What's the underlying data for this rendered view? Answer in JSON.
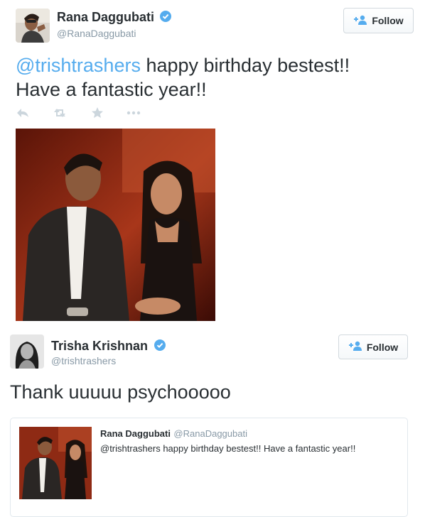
{
  "tweet1": {
    "user": {
      "name": "Rana Daggubati",
      "handle": "@RanaDaggubati",
      "verified": true
    },
    "follow_label": "Follow",
    "text_mention": "@trishtrashers",
    "text_rest": " happy birthday bestest!!",
    "text_line2": "Have a fantastic year!!",
    "actions": [
      "reply-icon",
      "retweet-icon",
      "favorite-icon",
      "more-icon"
    ]
  },
  "tweet2": {
    "user": {
      "name": "Trisha Krishnan",
      "handle": "@trishtrashers",
      "verified": true
    },
    "follow_label": "Follow",
    "text": "Thank uuuuu psychooooo",
    "quoted": {
      "name": "Rana Daggubati",
      "handle": "@RanaDaggubati",
      "text": "@trishtrashers happy birthday bestest!! Have a fantastic year!!"
    }
  },
  "colors": {
    "accent": "#55acee",
    "text": "#292f33",
    "muted": "#8899a6",
    "verified": "#55acee"
  }
}
